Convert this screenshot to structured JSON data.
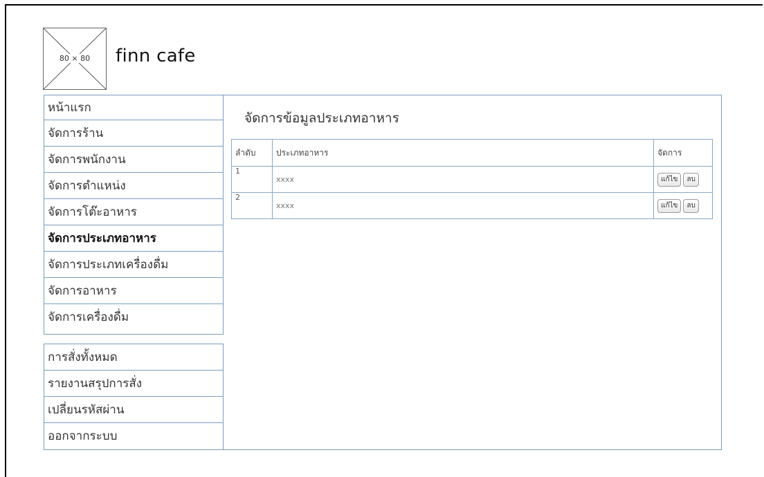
{
  "header": {
    "logo_label": "80 × 80",
    "app_name": "finn cafe"
  },
  "sidebar": {
    "primary_items": [
      {
        "label": "หน้าแรก"
      },
      {
        "label": "จัดการร้าน"
      },
      {
        "label": "จัดการพนักงาน"
      },
      {
        "label": "จัดการตำแหน่ง"
      },
      {
        "label": "จัดการโต๊ะอาหาร"
      },
      {
        "label": "จัดการประเภทอาหาร",
        "active": true
      },
      {
        "label": "จัดการประเภทเครื่องดื่ม"
      },
      {
        "label": "จัดการอาหาร"
      },
      {
        "label": "จัดการเครื่องดื่ม"
      }
    ],
    "secondary_items": [
      {
        "label": "การสั่งทั้งหมด"
      },
      {
        "label": "รายงานสรุปการสั่ง"
      },
      {
        "label": "เปลี่ยนรหัสผ่าน"
      },
      {
        "label": "ออกจากระบบ"
      }
    ]
  },
  "main": {
    "title": "จัดการข้อมูลประเภทอาหาร",
    "table": {
      "headers": [
        "ลำดับ",
        "ประเภทอาหาร",
        "จัดการ"
      ],
      "rows": [
        {
          "no": "1",
          "type": "xxxx",
          "edit_label": "แก้ไข",
          "delete_label": "ลบ"
        },
        {
          "no": "2",
          "type": "xxxx",
          "edit_label": "แก้ไข",
          "delete_label": "ลบ"
        }
      ]
    }
  },
  "colors": {
    "border": "#7a9cbc",
    "frame": "#000000",
    "background": "#ffffff"
  }
}
